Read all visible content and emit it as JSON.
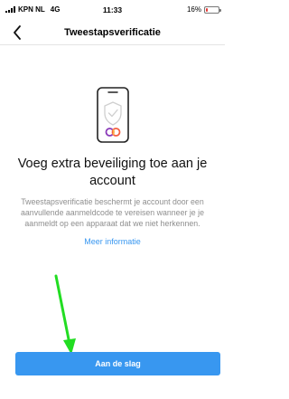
{
  "status_bar": {
    "carrier": "KPN NL",
    "network": "4G",
    "time": "11:33",
    "battery": "16%",
    "battery_level": 0.16,
    "battery_color": "#e53935"
  },
  "nav": {
    "back_icon": "chevron-left-icon",
    "title": "Tweestapsverificatie"
  },
  "illustration": {
    "icon": "phone-shield-icon"
  },
  "content": {
    "headline": "Voeg extra beveiliging toe aan je account",
    "description": "Tweestapsverificatie beschermt je account door een aanvullende aanmeldcode te vereisen wanneer je je aanmeldt op een apparaat dat we niet herkennen.",
    "more_info_link": "Meer informatie"
  },
  "annotation": {
    "icon": "arrow-down-icon",
    "color": "#22dd22"
  },
  "actions": {
    "primary_label": "Aan de slag",
    "primary_color": "#3897f0"
  }
}
